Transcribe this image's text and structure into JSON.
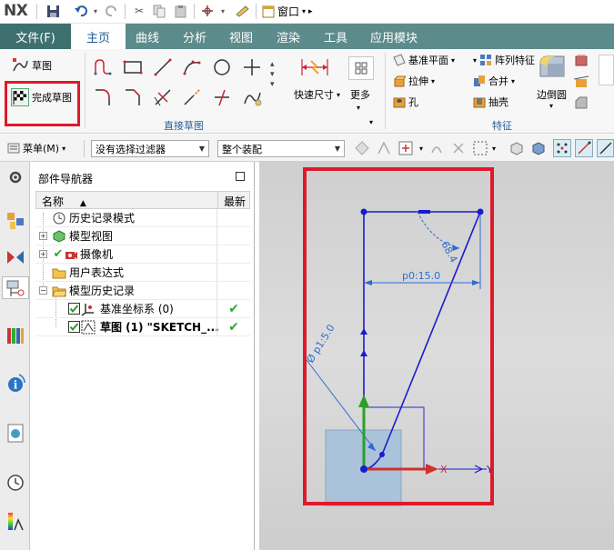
{
  "app": {
    "logo": "NX"
  },
  "titlebar": {
    "window_menu_label": "窗口"
  },
  "tabs": {
    "file": "文件(F)",
    "items": [
      "主页",
      "曲线",
      "分析",
      "视图",
      "渲染",
      "工具",
      "应用模块"
    ],
    "active": "主页"
  },
  "ribbon": {
    "sketch_label": "草图",
    "finish_sketch_label": "完成草图",
    "direct_sketch_group": "直接草图",
    "quick_dimension_label": "快速尺寸",
    "more_label": "更多",
    "feature_group": "特征",
    "datum_plane": "基准平面",
    "pattern_feature": "阵列特征",
    "extrude": "拉伸",
    "unite": "合并",
    "hole": "孔",
    "shell": "抽壳",
    "edge_blend": "边倒圆"
  },
  "selection_bar": {
    "menu_label": "菜单(M)",
    "filter_value": "没有选择过滤器",
    "scope_value": "整个装配"
  },
  "navigator": {
    "title": "部件导航器",
    "col_name": "名称",
    "col_latest": "最新",
    "rows": [
      {
        "label": "历史记录模式"
      },
      {
        "label": "模型视图"
      },
      {
        "label": "摄像机"
      },
      {
        "label": "用户表达式"
      },
      {
        "label": "模型历史记录"
      },
      {
        "label": "基准坐标系 (0)"
      },
      {
        "label": "草图 (1) \"SKETCH_..."
      }
    ]
  },
  "sketch": {
    "dim_angle": "68.4",
    "dim_horizontal": "p0:15.0",
    "dim_diameter": "Ø p1:5.0",
    "axis_x": "X",
    "axis_y": "Y"
  },
  "colors": {
    "tab_bar": "#5b8b8a",
    "file_tab": "#3f7070",
    "highlight_red": "#e0192a",
    "sketch_blue": "#1a1ad0",
    "dim_blue": "#2c6bd6",
    "check_green": "#2fa82f"
  }
}
